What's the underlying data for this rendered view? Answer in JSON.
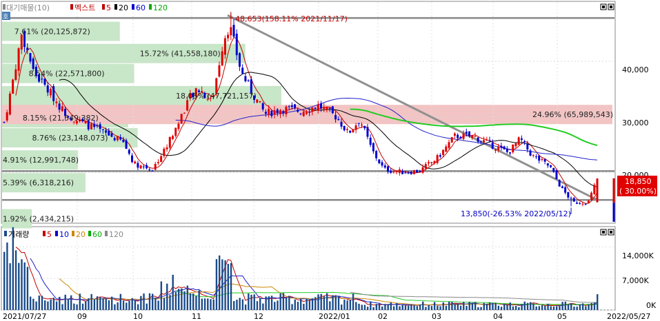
{
  "legend_top": {
    "icon_text": "호",
    "items": [
      {
        "text": "대기매물(10)",
        "color": "#888888"
      },
      {
        "text": "멕스트",
        "color": "#c00000"
      },
      {
        "text": "5",
        "color": "#c00000"
      },
      {
        "text": "20",
        "color": "#000000"
      },
      {
        "text": "60",
        "color": "#0000cc"
      },
      {
        "text": "120",
        "color": "#00aa00"
      }
    ]
  },
  "legend_bottom": {
    "items": [
      {
        "text": "거래량",
        "color": "#000000"
      },
      {
        "text": "5",
        "color": "#c00000"
      },
      {
        "text": "10",
        "color": "#0000cc"
      },
      {
        "text": "20",
        "color": "#cc8800"
      },
      {
        "text": "60",
        "color": "#00aa00"
      },
      {
        "text": "120",
        "color": "#888888"
      }
    ]
  },
  "colors": {
    "up": "#e00000",
    "down": "#0000d0",
    "ma5": "#c00000",
    "ma20": "#000000",
    "ma60": "#2020cc",
    "ma120": "#22cc22",
    "profile_green": "#c8e6c8",
    "profile_red": "#f2c4c4",
    "trend": "#909090"
  },
  "chart_data": [
    {
      "type": "candlestick",
      "x_ticks": [
        "2021/07/27",
        "09",
        "10",
        "11",
        "12",
        "2022/01",
        "02",
        "03",
        "04",
        "05",
        "2022/05/27"
      ],
      "y_ticks": [
        20000,
        30000,
        40000
      ],
      "y_tick_labels": [
        "20,000",
        "30,000",
        "40,000"
      ],
      "ylim": [
        10800,
        50800
      ],
      "last_price": {
        "value": 18850,
        "label": "18,850",
        "change_label": "( 30.00%)"
      },
      "annotations": {
        "high": {
          "value": 48653,
          "label": "48,653(158.11% 2021/11/17)"
        },
        "low": {
          "value": 13850,
          "label": "13,850(-26.53% 2022/05/12)"
        }
      },
      "horizontal_lines": [
        47800,
        20200,
        15000
      ],
      "volume_profile": [
        {
          "price": 11600,
          "label": "1.92% (2,434,215)",
          "share": 1.92,
          "highlight": false
        },
        {
          "price": 18100,
          "label": "5.39% (6,318,216)",
          "share": 5.39,
          "highlight": false
        },
        {
          "price": 22200,
          "label": "4.91% (12,991,748)",
          "share": 4.91,
          "highlight": false
        },
        {
          "price": 26200,
          "label": "8.76% (23,148,073)",
          "share": 8.76,
          "highlight": false
        },
        {
          "price": 29800,
          "label": "8.15% (21,549,382)",
          "share": 8.15,
          "highlight": false
        },
        {
          "price": 33800,
          "label": "18.05% (47,721,157)",
          "share": 18.05,
          "highlight": false
        },
        {
          "price": 37800,
          "label": "8.54% (22,571,800)",
          "share": 8.54,
          "highlight": false
        },
        {
          "price": 41400,
          "label": "15.72% (41,558,180)",
          "share": 15.72,
          "highlight": false
        },
        {
          "price": 45400,
          "label": "7.61% (20,125,872)",
          "share": 7.61,
          "highlight": false
        },
        {
          "price": 30400,
          "label": "24.96% (65,989,543)",
          "share": 24.96,
          "highlight": true
        }
      ]
    },
    {
      "type": "bar",
      "title": "거래량",
      "y_ticks": [
        0,
        7000,
        14000
      ],
      "y_tick_labels": [
        "0K",
        "7,000K",
        "14,000K"
      ],
      "ylim": [
        0,
        18500
      ]
    }
  ]
}
